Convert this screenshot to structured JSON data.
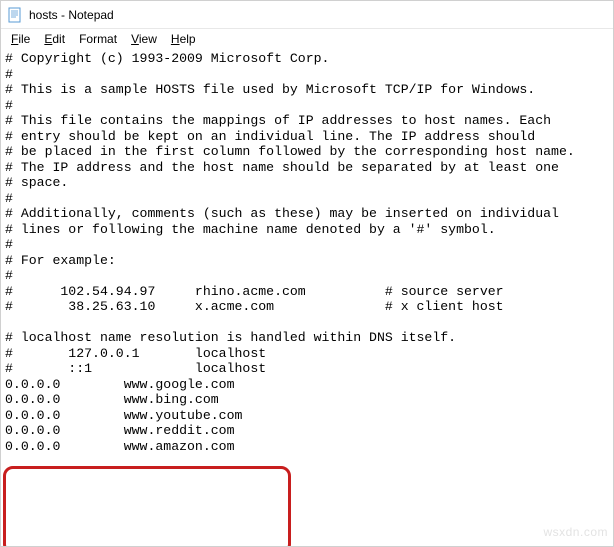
{
  "window": {
    "title": "hosts - Notepad"
  },
  "menu": {
    "file": "File",
    "edit": "Edit",
    "format": "Format",
    "view": "View",
    "help": "Help"
  },
  "editor": {
    "content": "# Copyright (c) 1993-2009 Microsoft Corp.\n#\n# This is a sample HOSTS file used by Microsoft TCP/IP for Windows.\n#\n# This file contains the mappings of IP addresses to host names. Each\n# entry should be kept on an individual line. The IP address should\n# be placed in the first column followed by the corresponding host name.\n# The IP address and the host name should be separated by at least one\n# space.\n#\n# Additionally, comments (such as these) may be inserted on individual\n# lines or following the machine name denoted by a '#' symbol.\n#\n# For example:\n#\n#      102.54.94.97     rhino.acme.com          # source server\n#       38.25.63.10     x.acme.com              # x client host\n\n# localhost name resolution is handled within DNS itself.\n#       127.0.0.1       localhost\n#       ::1             localhost\n0.0.0.0        www.google.com\n0.0.0.0        www.bing.com\n0.0.0.0        www.youtube.com\n0.0.0.0        www.reddit.com\n0.0.0.0        www.amazon.com"
  },
  "watermark": {
    "text": "wsxdn.com"
  }
}
